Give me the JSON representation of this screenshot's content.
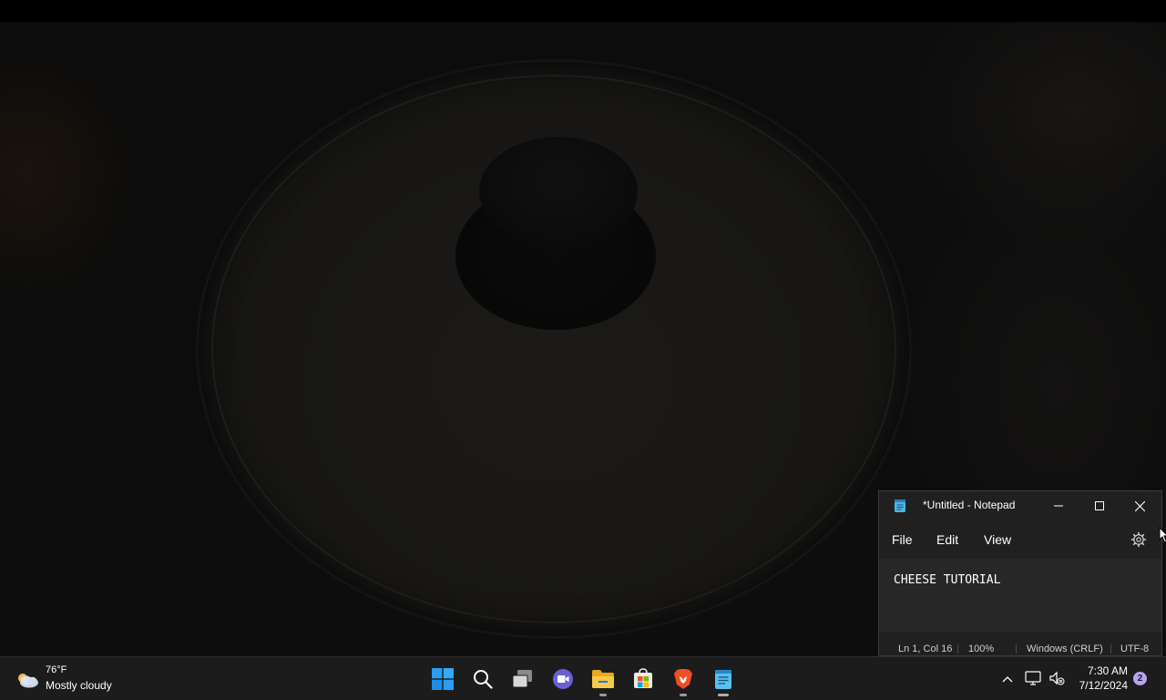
{
  "notepad": {
    "title": "*Untitled - Notepad",
    "menu": {
      "file": "File",
      "edit": "Edit",
      "view": "View"
    },
    "content": "CHEESE TUTORIAL",
    "status": {
      "position": "Ln 1, Col 16",
      "zoom": "100%",
      "line_ending": "Windows (CRLF)",
      "encoding": "UTF-8"
    }
  },
  "taskbar": {
    "weather": {
      "temperature": "76°F",
      "condition": "Mostly cloudy",
      "icon": "partly-cloudy-icon"
    },
    "apps": [
      {
        "name": "Start",
        "icon": "windows-logo-icon"
      },
      {
        "name": "Search",
        "icon": "search-icon"
      },
      {
        "name": "Task View",
        "icon": "task-view-icon"
      },
      {
        "name": "Meet",
        "icon": "video-call-icon"
      },
      {
        "name": "File Explorer",
        "icon": "folder-icon",
        "running": true
      },
      {
        "name": "Microsoft Store",
        "icon": "store-icon"
      },
      {
        "name": "Brave",
        "icon": "brave-lion-icon",
        "running": true
      },
      {
        "name": "Notepad",
        "icon": "notepad-icon",
        "running": true,
        "active": true
      }
    ],
    "clock": {
      "time": "7:30 AM",
      "date": "7/12/2024"
    },
    "notifications": "2"
  },
  "colors": {
    "taskbar_bg": "#1c1c1c",
    "window_bg": "#202020",
    "editor_bg": "#272727",
    "accent": "#0078d4",
    "badge": "#b6a6f0"
  }
}
